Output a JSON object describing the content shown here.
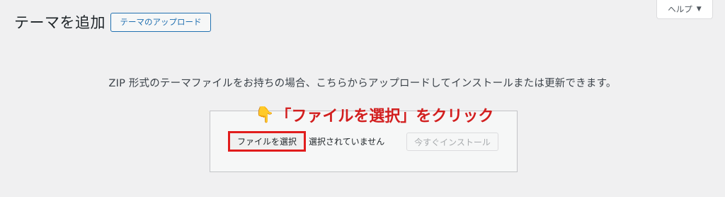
{
  "header": {
    "title": "テーマを追加",
    "upload_button": "テーマのアップロード"
  },
  "help_tab": {
    "label": "ヘルプ",
    "caret": "▼"
  },
  "description": "ZIP 形式のテーマファイルをお持ちの場合、こちらからアップロードしてインストールまたは更新できます。",
  "annotation": {
    "icon": "👇",
    "text": "「ファイルを選択」をクリック"
  },
  "upload_form": {
    "choose_file_label": "ファイルを選択",
    "no_file_text": "選択されていません",
    "install_now_label": "今すぐインストール"
  },
  "colors": {
    "accent": "#2271b1",
    "annotation_red": "#d21e1e",
    "highlight_border": "#e11d1d"
  }
}
